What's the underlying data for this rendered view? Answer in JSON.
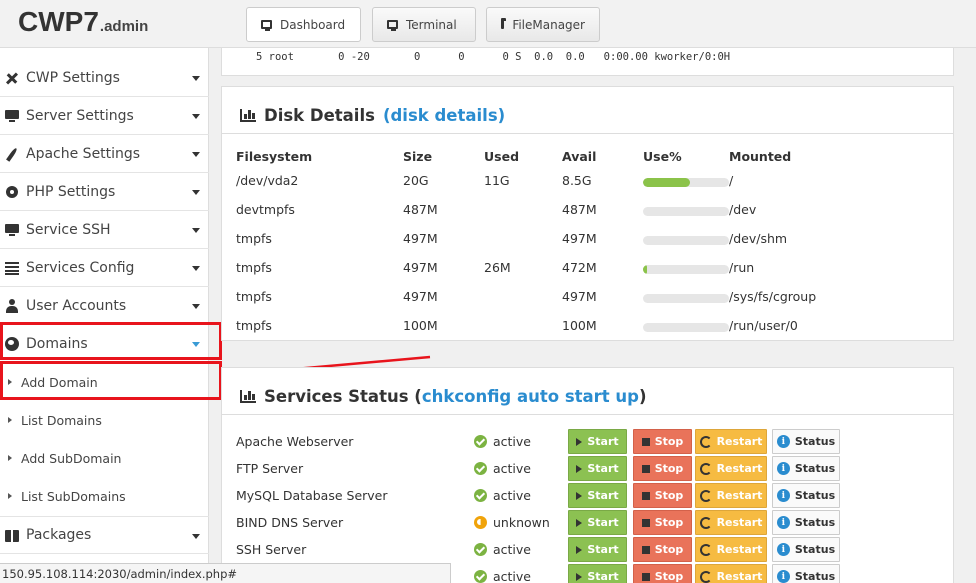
{
  "app": {
    "title": "CWP7",
    "subtitle": ".admin"
  },
  "topnav": [
    {
      "label": "Dashboard",
      "icon": "monitor-icon",
      "active": true
    },
    {
      "label": "Terminal",
      "icon": "monitor-icon",
      "active": false
    },
    {
      "label": "FileManager",
      "icon": "folder-icon",
      "active": false
    }
  ],
  "process_line": "5 root       0 -20       0      0      0 S  0.0  0.0   0:00.00 kworker/0:0H",
  "sidebar": {
    "items": [
      {
        "label": "CWP Settings",
        "icon": "wrench-icon"
      },
      {
        "label": "Server Settings",
        "icon": "monitor-icon"
      },
      {
        "label": "Apache Settings",
        "icon": "feather-icon"
      },
      {
        "label": "PHP Settings",
        "icon": "gear-icon"
      },
      {
        "label": "Service SSH",
        "icon": "monitor-icon"
      },
      {
        "label": "Services Config",
        "icon": "list-icon"
      },
      {
        "label": "User Accounts",
        "icon": "user-icon"
      },
      {
        "label": "Domains",
        "icon": "globe-icon"
      },
      {
        "label": "Packages",
        "icon": "package-icon"
      }
    ],
    "domains_sub": [
      "Add Domain",
      "List Domains",
      "Add SubDomain",
      "List SubDomains"
    ]
  },
  "disk": {
    "title": "Disk Details",
    "link": "(disk details)",
    "headers": [
      "Filesystem",
      "Size",
      "Used",
      "Avail",
      "Use%",
      "Mounted"
    ],
    "rows": [
      {
        "fs": "/dev/vda2",
        "size": "20G",
        "used": "11G",
        "avail": "8.5G",
        "use": 55,
        "mount": "/"
      },
      {
        "fs": "devtmpfs",
        "size": "487M",
        "used": "",
        "avail": "487M",
        "use": 0,
        "mount": "/dev"
      },
      {
        "fs": "tmpfs",
        "size": "497M",
        "used": "",
        "avail": "497M",
        "use": 0,
        "mount": "/dev/shm"
      },
      {
        "fs": "tmpfs",
        "size": "497M",
        "used": "26M",
        "avail": "472M",
        "use": 5,
        "mount": "/run"
      },
      {
        "fs": "tmpfs",
        "size": "497M",
        "used": "",
        "avail": "497M",
        "use": 0,
        "mount": "/sys/fs/cgroup"
      },
      {
        "fs": "tmpfs",
        "size": "100M",
        "used": "",
        "avail": "100M",
        "use": 0,
        "mount": "/run/user/0"
      }
    ]
  },
  "services": {
    "title": "Services Status",
    "link_open": "(",
    "link": "chkconfig auto start up",
    "link_close": ")",
    "buttons": {
      "start": "Start",
      "stop": "Stop",
      "restart": "Restart",
      "status": "Status"
    },
    "rows": [
      {
        "name": "Apache Webserver",
        "status": "active",
        "state": "ok"
      },
      {
        "name": "FTP Server",
        "status": "active",
        "state": "ok"
      },
      {
        "name": "MySQL Database Server",
        "status": "active",
        "state": "ok"
      },
      {
        "name": "BIND DNS Server",
        "status": "unknown",
        "state": "warn"
      },
      {
        "name": "SSH Server",
        "status": "active",
        "state": "ok"
      },
      {
        "name": "",
        "status": "active",
        "state": "ok"
      }
    ]
  },
  "statusbar": "150.95.108.114:2030/admin/index.php#",
  "colors": {
    "highlight": "#e8141c",
    "link": "#2a8ccf",
    "start": "#8cc152",
    "stop": "#e9735a",
    "restart": "#f6bb42"
  }
}
